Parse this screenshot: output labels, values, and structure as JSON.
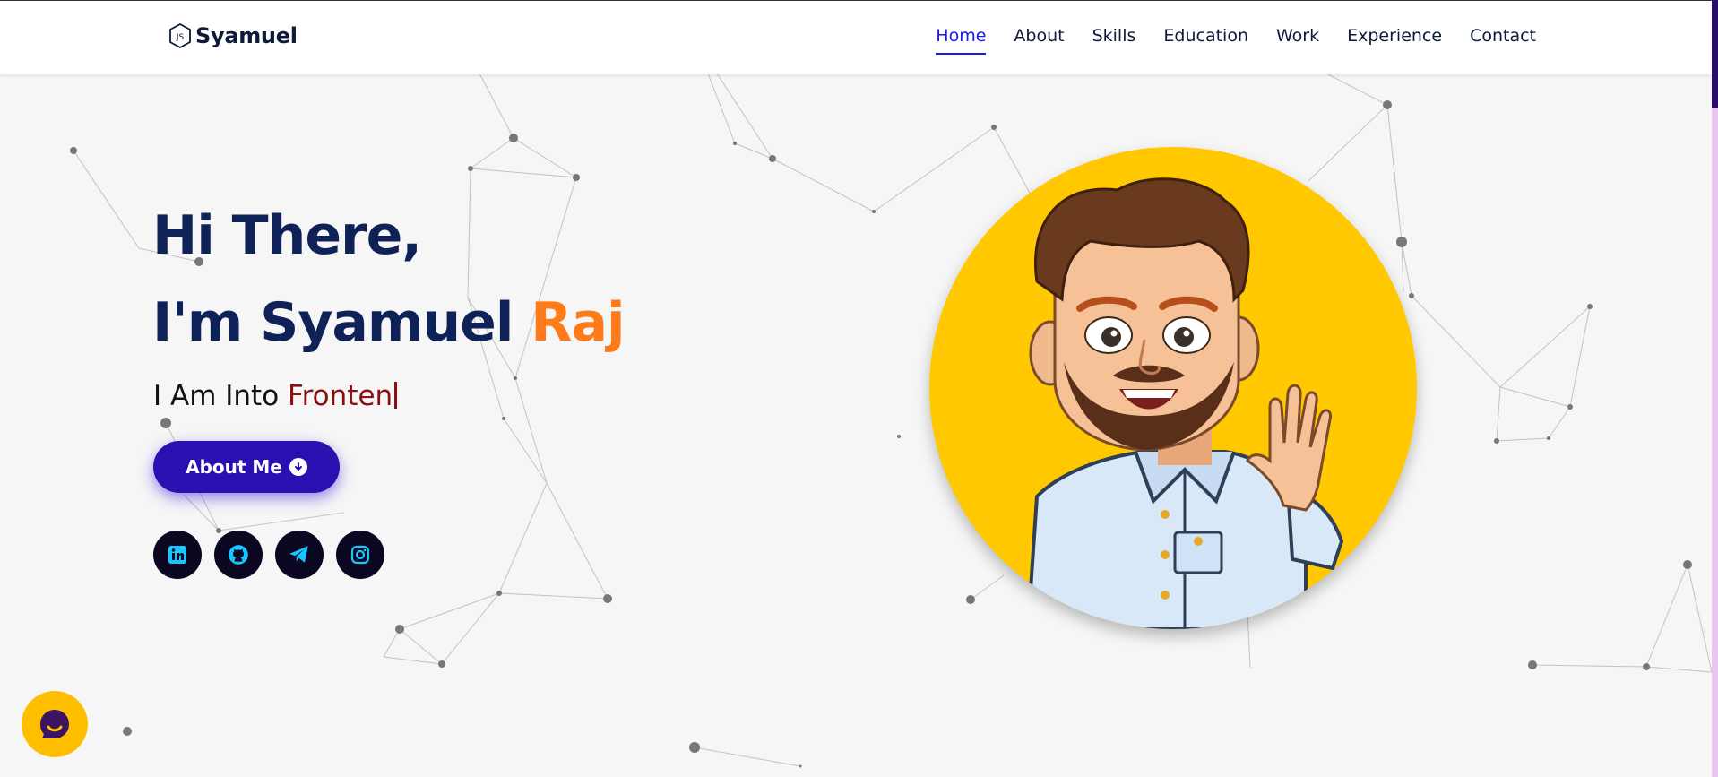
{
  "header": {
    "brand": "Syamuel",
    "logo_icon": "js-hexagon-icon",
    "nav": [
      {
        "label": "Home",
        "active": true
      },
      {
        "label": "About"
      },
      {
        "label": "Skills"
      },
      {
        "label": "Education"
      },
      {
        "label": "Work"
      },
      {
        "label": "Experience"
      },
      {
        "label": "Contact"
      }
    ]
  },
  "hero": {
    "greeting": "Hi There,",
    "name_prefix": "I'm Syamuel ",
    "name_accent": "Raj",
    "typed_prefix": "I Am Into ",
    "typed_word": "Fronten",
    "button_label": "About Me",
    "button_icon": "arrow-down-circle-icon",
    "socials": [
      "linkedin-icon",
      "github-icon",
      "telegram-icon",
      "instagram-icon"
    ]
  },
  "colors": {
    "heading": "#0e2257",
    "accent": "#ff7a18",
    "typed": "#8b0f0f",
    "button": "#2b0fb0",
    "social_bg": "#0b0720",
    "social_icon": "#15c6ff",
    "avatar_bg": "#ffc800",
    "chat_bg": "#ffbf00",
    "active_nav": "#1a1ae6"
  },
  "chat_widget": {
    "icon": "chat-bubble-icon"
  }
}
